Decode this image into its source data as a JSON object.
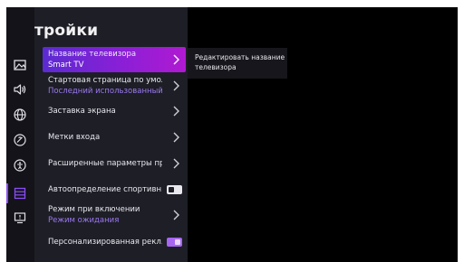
{
  "header": {
    "title": "тройки"
  },
  "sidebar": {
    "icons": [
      "picture-icon",
      "sound-icon",
      "network-icon",
      "accessibility-ring-icon",
      "accessibility-icon",
      "system-list-icon",
      "support-info-icon"
    ],
    "active_index": 5
  },
  "menu": {
    "items": [
      {
        "label": "Название телевизора",
        "value": "Smart TV",
        "control": "chevron",
        "selected": true
      },
      {
        "label": "Стартовая страница по умол…",
        "value": "Последний использованный…",
        "control": "chevron"
      },
      {
        "label": "Заставка экрана",
        "control": "chevron"
      },
      {
        "label": "Метки входа",
        "control": "chevron"
      },
      {
        "label": "Расширенные параметры пр…",
        "control": "chevron"
      },
      {
        "label": "Автоопределение спортивн…",
        "control": "toggle",
        "checked": false
      },
      {
        "label": "Режим при включении",
        "value": "Режим ожидания",
        "control": "chevron"
      },
      {
        "label": "Персонализированная рекл…",
        "control": "toggle",
        "checked": true
      }
    ]
  },
  "hint": {
    "text": "Редактировать название телевизора"
  },
  "colors": {
    "accent": "#8a4ef5",
    "value_text": "#9c79f0",
    "panel_bg": "#1d1e26",
    "sidebar_bg": "#131319"
  }
}
